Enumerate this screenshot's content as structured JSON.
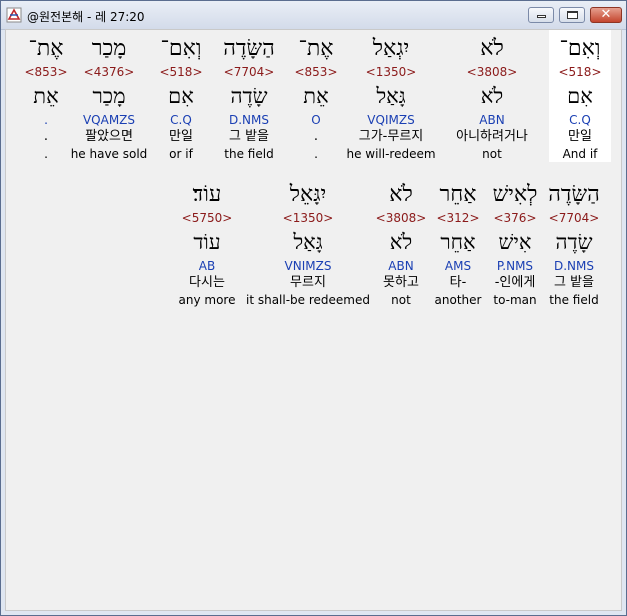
{
  "window": {
    "title": "@원전본해 - 레 27:20",
    "close_glyph": "✕"
  },
  "rows": [
    [
      {
        "heb": "וְאִם־",
        "strong": "<518>",
        "root": "אִם",
        "morph": "C.Q",
        "kor": "만일",
        "eng": "And if",
        "highlight": true
      },
      {
        "heb": "לֹא",
        "strong": "<3808>",
        "root": "לֹא",
        "morph": "ABN",
        "kor": "아니하려거나",
        "eng": "not"
      },
      {
        "heb": "יִגְאַל",
        "strong": "<1350>",
        "root": "גָּאַל",
        "morph": "VQIMZS",
        "kor": "그가-무르지",
        "eng": "he will-redeem"
      },
      {
        "heb": "אֶת־",
        "strong": "<853>",
        "root": "אֵת",
        "morph": "O",
        "kor": ".",
        "eng": "."
      },
      {
        "heb": "הַשָּׂדֶה",
        "strong": "<7704>",
        "root": "שָׂדֶה",
        "morph": "D.NMS",
        "kor": "그 밭을",
        "eng": "the field"
      },
      {
        "heb": "וְאִם־",
        "strong": "<518>",
        "root": "אִם",
        "morph": "C.Q",
        "kor": "만일",
        "eng": "or if"
      },
      {
        "heb": "מָכַר",
        "strong": "<4376>",
        "root": "מָכַר",
        "morph": "VQAMZS",
        "kor": "팔았으면",
        "eng": "he have sold"
      },
      {
        "heb": "אֶת־",
        "strong": "<853>",
        "root": "אֵת",
        "morph": ".",
        "kor": ".",
        "eng": "."
      }
    ],
    [
      {
        "heb": "הַשָּׂדֶה",
        "strong": "<7704>",
        "root": "שָׂדֶה",
        "morph": "D.NMS",
        "kor": "그 밭을",
        "eng": "the field"
      },
      {
        "heb": "לְאִישׁ",
        "strong": "<376>",
        "root": "אִישׁ",
        "morph": "P.NMS",
        "kor": "-인에게",
        "eng": "to-man"
      },
      {
        "heb": "אַחֵר",
        "strong": "<312>",
        "root": "אַחֵר",
        "morph": "AMS",
        "kor": "타-",
        "eng": "another"
      },
      {
        "heb": "לֹא",
        "strong": "<3808>",
        "root": "לֹא",
        "morph": "ABN",
        "kor": "못하고",
        "eng": "not"
      },
      {
        "heb": "יִגָּאֵל",
        "strong": "<1350>",
        "root": "גָּאַל",
        "morph": "VNIMZS",
        "kor": "무르지",
        "eng": "it shall-be redeemed"
      },
      {
        "heb": "עוֹד׃",
        "strong": "<5750>",
        "root": "עוֹד",
        "morph": "AB",
        "kor": "다시는",
        "eng": "any more"
      }
    ]
  ]
}
